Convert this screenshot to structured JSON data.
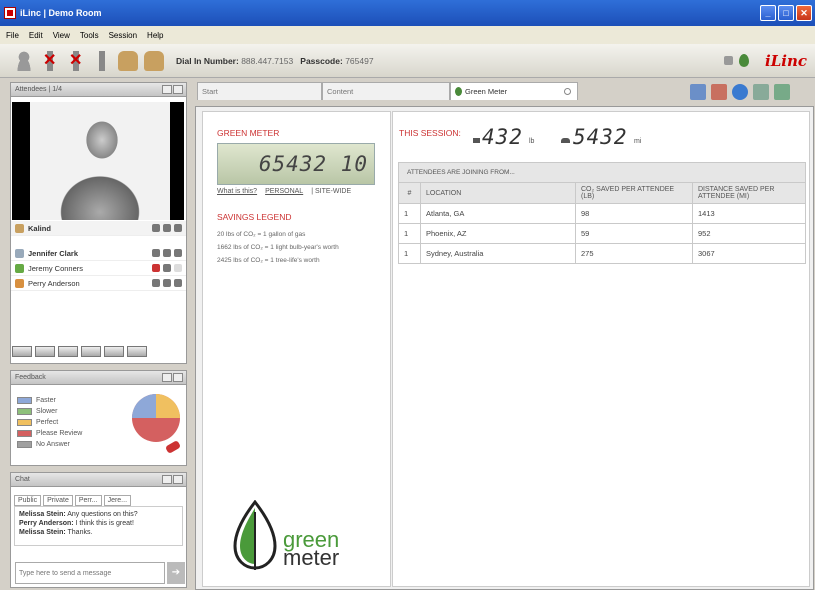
{
  "window": {
    "title": "iLinc | Demo Room"
  },
  "menu": [
    "File",
    "Edit",
    "View",
    "Tools",
    "Session",
    "Help"
  ],
  "toolbar": {
    "dial_label": "Dial In Number:",
    "dial_number": "888.447.7153",
    "passcode_label": "Passcode:",
    "passcode": "765497",
    "brand": "iLinc"
  },
  "attendees": {
    "title": "Attendees | 1/4",
    "featured": "Kalind",
    "people": [
      "Jennifer Clark",
      "Jeremy Conners",
      "Perry Anderson"
    ]
  },
  "feedback": {
    "title": "Feedback",
    "options": [
      {
        "label": "Faster",
        "color": "#8ea8d8"
      },
      {
        "label": "Slower",
        "color": "#8dc07a"
      },
      {
        "label": "Perfect",
        "color": "#f0c060"
      },
      {
        "label": "Please Review",
        "color": "#d46060"
      },
      {
        "label": "No Answer",
        "color": "#a0a0a0"
      }
    ]
  },
  "chat": {
    "title": "Chat",
    "tabs": [
      "Public",
      "Private",
      "Perr...",
      "Jere..."
    ],
    "messages": [
      {
        "from": "Melissa Stein:",
        "text": "Any questions on this?"
      },
      {
        "from": "Perry Anderson:",
        "text": "I think this is great!"
      },
      {
        "from": "Melissa Stein:",
        "text": "Thanks."
      }
    ],
    "placeholder": "Type here to send a message"
  },
  "tabs": {
    "start": "Start",
    "content": "Content",
    "green": "Green Meter"
  },
  "green": {
    "heading": "GREEN METER",
    "lcd": "65432 10",
    "what": "What is this?",
    "personal": "PERSONAL",
    "sitewide": "| SITE-WIDE",
    "legend_title": "SAVINGS LEGEND",
    "legend": [
      "20 lbs of CO₂ = 1 gallon of gas",
      "1662 lbs of CO₂ = 1 light bulb-year's worth",
      "2425 lbs of CO₂ = 1 tree-life's worth"
    ],
    "logo_top": "green",
    "logo_bottom": "meter"
  },
  "session": {
    "label": "THIS SESSION:",
    "lbs": "432",
    "lbs_unit": "lb",
    "mi": "5432",
    "mi_unit": "mi"
  },
  "table": {
    "title": "ATTENDEES ARE JOINING FROM...",
    "headers": [
      "#",
      "LOCATION",
      "CO₂ SAVED PER ATTENDEE (LB)",
      "DISTANCE SAVED PER ATTENDEE (MI)"
    ],
    "rows": [
      [
        "1",
        "Atlanta, GA",
        "98",
        "1413"
      ],
      [
        "1",
        "Phoenix, AZ",
        "59",
        "952"
      ],
      [
        "1",
        "Sydney, Australia",
        "275",
        "3067"
      ]
    ]
  }
}
